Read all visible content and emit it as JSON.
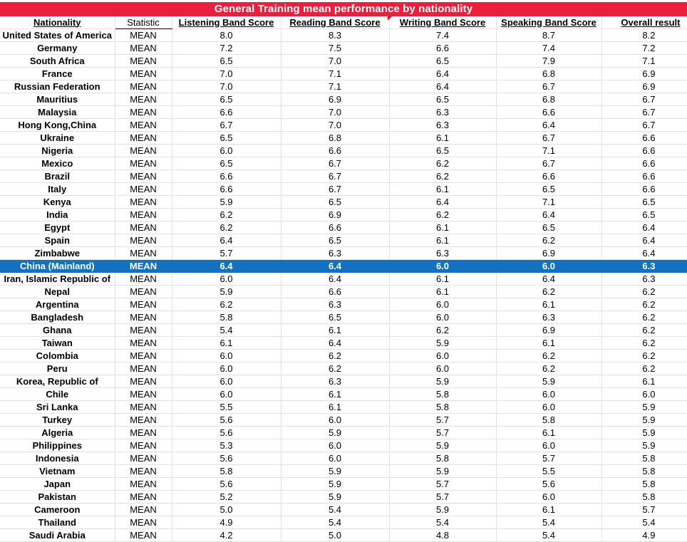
{
  "title": "General Training mean performance by nationality",
  "headers": {
    "nationality": "Nationality",
    "statistic": "Statistic",
    "listening": "Listening Band Score",
    "reading": "Reading Band Score",
    "writing": "Writing Band Score",
    "speaking": "Speaking Band Score",
    "overall": "Overall result"
  },
  "highlight_color": "#1470c1",
  "title_color": "#ea1f3d",
  "rows": [
    {
      "nationality": "United States of America",
      "statistic": "MEAN",
      "listening": "8.0",
      "reading": "8.3",
      "writing": "7.4",
      "speaking": "8.7",
      "overall": "8.2"
    },
    {
      "nationality": "Germany",
      "statistic": "MEAN",
      "listening": "7.2",
      "reading": "7.5",
      "writing": "6.6",
      "speaking": "7.4",
      "overall": "7.2"
    },
    {
      "nationality": "South Africa",
      "statistic": "MEAN",
      "listening": "6.5",
      "reading": "7.0",
      "writing": "6.5",
      "speaking": "7.9",
      "overall": "7.1"
    },
    {
      "nationality": "France",
      "statistic": "MEAN",
      "listening": "7.0",
      "reading": "7.1",
      "writing": "6.4",
      "speaking": "6.8",
      "overall": "6.9"
    },
    {
      "nationality": "Russian Federation",
      "statistic": "MEAN",
      "listening": "7.0",
      "reading": "7.1",
      "writing": "6.4",
      "speaking": "6.7",
      "overall": "6.9"
    },
    {
      "nationality": "Mauritius",
      "statistic": "MEAN",
      "listening": "6.5",
      "reading": "6.9",
      "writing": "6.5",
      "speaking": "6.8",
      "overall": "6.7"
    },
    {
      "nationality": "Malaysia",
      "statistic": "MEAN",
      "listening": "6.6",
      "reading": "7.0",
      "writing": "6.3",
      "speaking": "6.6",
      "overall": "6.7"
    },
    {
      "nationality": "Hong Kong,China",
      "statistic": "MEAN",
      "listening": "6.7",
      "reading": "7.0",
      "writing": "6.3",
      "speaking": "6.4",
      "overall": "6.7"
    },
    {
      "nationality": "Ukraine",
      "statistic": "MEAN",
      "listening": "6.5",
      "reading": "6.8",
      "writing": "6.1",
      "speaking": "6.7",
      "overall": "6.6"
    },
    {
      "nationality": "Nigeria",
      "statistic": "MEAN",
      "listening": "6.0",
      "reading": "6.6",
      "writing": "6.5",
      "speaking": "7.1",
      "overall": "6.6"
    },
    {
      "nationality": "Mexico",
      "statistic": "MEAN",
      "listening": "6.5",
      "reading": "6.7",
      "writing": "6.2",
      "speaking": "6.7",
      "overall": "6.6"
    },
    {
      "nationality": "Brazil",
      "statistic": "MEAN",
      "listening": "6.6",
      "reading": "6.7",
      "writing": "6.2",
      "speaking": "6.6",
      "overall": "6.6"
    },
    {
      "nationality": "Italy",
      "statistic": "MEAN",
      "listening": "6.6",
      "reading": "6.7",
      "writing": "6.1",
      "speaking": "6.5",
      "overall": "6.6"
    },
    {
      "nationality": "Kenya",
      "statistic": "MEAN",
      "listening": "5.9",
      "reading": "6.5",
      "writing": "6.4",
      "speaking": "7.1",
      "overall": "6.5"
    },
    {
      "nationality": "India",
      "statistic": "MEAN",
      "listening": "6.2",
      "reading": "6.9",
      "writing": "6.2",
      "speaking": "6.4",
      "overall": "6.5"
    },
    {
      "nationality": "Egypt",
      "statistic": "MEAN",
      "listening": "6.2",
      "reading": "6.6",
      "writing": "6.1",
      "speaking": "6.5",
      "overall": "6.4"
    },
    {
      "nationality": "Spain",
      "statistic": "MEAN",
      "listening": "6.4",
      "reading": "6.5",
      "writing": "6.1",
      "speaking": "6.2",
      "overall": "6.4"
    },
    {
      "nationality": "Zimbabwe",
      "statistic": "MEAN",
      "listening": "5.7",
      "reading": "6.3",
      "writing": "6.3",
      "speaking": "6.9",
      "overall": "6.4"
    },
    {
      "nationality": "China (Mainland)",
      "statistic": "MEAN",
      "listening": "6.4",
      "reading": "6.4",
      "writing": "6.0",
      "speaking": "6.0",
      "overall": "6.3",
      "highlighted": true
    },
    {
      "nationality": "Iran, Islamic Republic of",
      "statistic": "MEAN",
      "listening": "6.0",
      "reading": "6.4",
      "writing": "6.1",
      "speaking": "6.4",
      "overall": "6.3"
    },
    {
      "nationality": "Nepal",
      "statistic": "MEAN",
      "listening": "5.9",
      "reading": "6.6",
      "writing": "6.1",
      "speaking": "6.2",
      "overall": "6.2"
    },
    {
      "nationality": "Argentina",
      "statistic": "MEAN",
      "listening": "6.2",
      "reading": "6.3",
      "writing": "6.0",
      "speaking": "6.1",
      "overall": "6.2"
    },
    {
      "nationality": "Bangladesh",
      "statistic": "MEAN",
      "listening": "5.8",
      "reading": "6.5",
      "writing": "6.0",
      "speaking": "6.3",
      "overall": "6.2"
    },
    {
      "nationality": "Ghana",
      "statistic": "MEAN",
      "listening": "5.4",
      "reading": "6.1",
      "writing": "6.2",
      "speaking": "6.9",
      "overall": "6.2"
    },
    {
      "nationality": "Taiwan",
      "statistic": "MEAN",
      "listening": "6.1",
      "reading": "6.4",
      "writing": "5.9",
      "speaking": "6.1",
      "overall": "6.2"
    },
    {
      "nationality": "Colombia",
      "statistic": "MEAN",
      "listening": "6.0",
      "reading": "6.2",
      "writing": "6.0",
      "speaking": "6.2",
      "overall": "6.2"
    },
    {
      "nationality": "Peru",
      "statistic": "MEAN",
      "listening": "6.0",
      "reading": "6.2",
      "writing": "6.0",
      "speaking": "6.2",
      "overall": "6.2"
    },
    {
      "nationality": "Korea, Republic of",
      "statistic": "MEAN",
      "listening": "6.0",
      "reading": "6.3",
      "writing": "5.9",
      "speaking": "5.9",
      "overall": "6.1"
    },
    {
      "nationality": "Chile",
      "statistic": "MEAN",
      "listening": "6.0",
      "reading": "6.1",
      "writing": "5.8",
      "speaking": "6.0",
      "overall": "6.0"
    },
    {
      "nationality": "Sri Lanka",
      "statistic": "MEAN",
      "listening": "5.5",
      "reading": "6.1",
      "writing": "5.8",
      "speaking": "6.0",
      "overall": "5.9"
    },
    {
      "nationality": "Turkey",
      "statistic": "MEAN",
      "listening": "5.6",
      "reading": "6.0",
      "writing": "5.7",
      "speaking": "5.8",
      "overall": "5.9"
    },
    {
      "nationality": "Algeria",
      "statistic": "MEAN",
      "listening": "5.6",
      "reading": "5.9",
      "writing": "5.7",
      "speaking": "6.1",
      "overall": "5.9"
    },
    {
      "nationality": "Philippines",
      "statistic": "MEAN",
      "listening": "5.3",
      "reading": "6.0",
      "writing": "5.9",
      "speaking": "6.0",
      "overall": "5.9"
    },
    {
      "nationality": "Indonesia",
      "statistic": "MEAN",
      "listening": "5.6",
      "reading": "6.0",
      "writing": "5.8",
      "speaking": "5.7",
      "overall": "5.8"
    },
    {
      "nationality": "Vietnam",
      "statistic": "MEAN",
      "listening": "5.8",
      "reading": "5.9",
      "writing": "5.9",
      "speaking": "5.5",
      "overall": "5.8"
    },
    {
      "nationality": "Japan",
      "statistic": "MEAN",
      "listening": "5.6",
      "reading": "5.9",
      "writing": "5.7",
      "speaking": "5.6",
      "overall": "5.8"
    },
    {
      "nationality": "Pakistan",
      "statistic": "MEAN",
      "listening": "5.2",
      "reading": "5.9",
      "writing": "5.7",
      "speaking": "6.0",
      "overall": "5.8"
    },
    {
      "nationality": "Cameroon",
      "statistic": "MEAN",
      "listening": "5.0",
      "reading": "5.4",
      "writing": "5.9",
      "speaking": "6.1",
      "overall": "5.7"
    },
    {
      "nationality": "Thailand",
      "statistic": "MEAN",
      "listening": "4.9",
      "reading": "5.4",
      "writing": "5.4",
      "speaking": "5.4",
      "overall": "5.4"
    },
    {
      "nationality": "Saudi Arabia",
      "statistic": "MEAN",
      "listening": "4.2",
      "reading": "5.0",
      "writing": "4.8",
      "speaking": "5.4",
      "overall": "4.9"
    }
  ]
}
